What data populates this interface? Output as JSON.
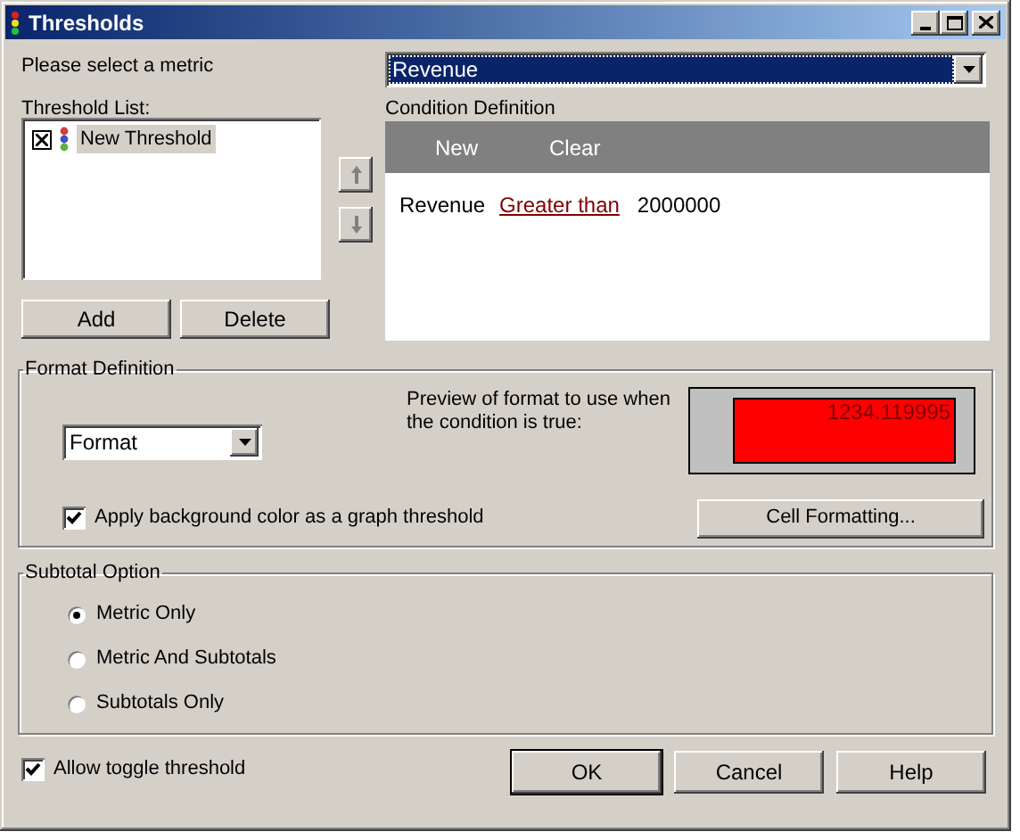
{
  "window": {
    "title": "Thresholds"
  },
  "metric": {
    "label": "Please select a metric",
    "value": "Revenue"
  },
  "threshold_list": {
    "label": "Threshold List:",
    "items": [
      {
        "label": "New Threshold",
        "checked": true,
        "selected": true
      }
    ]
  },
  "list_buttons": [
    "Add",
    "Delete"
  ],
  "condition": {
    "label": "Condition Definition",
    "toolbar": [
      "New",
      "Clear"
    ],
    "rows": [
      {
        "metric": "Revenue",
        "operator": "Greater than",
        "value": "2000000"
      }
    ]
  },
  "format": {
    "title": "Format Definition",
    "combo": "Format",
    "preview_label": "Preview of format to use when the condition is true:",
    "preview_value": "1234.119995",
    "graph_threshold": {
      "label": "Apply background color as a graph threshold",
      "checked": true
    },
    "button": "Cell Formatting..."
  },
  "subtotal": {
    "title": "Subtotal Option",
    "options": [
      {
        "label": "Metric Only",
        "selected": true
      },
      {
        "label": "Metric And Subtotals",
        "selected": false
      },
      {
        "label": "Subtotals Only",
        "selected": false
      }
    ]
  },
  "allow_toggle": {
    "label": "Allow toggle threshold",
    "checked": true
  },
  "buttons": [
    "OK",
    "Cancel",
    "Help"
  ]
}
